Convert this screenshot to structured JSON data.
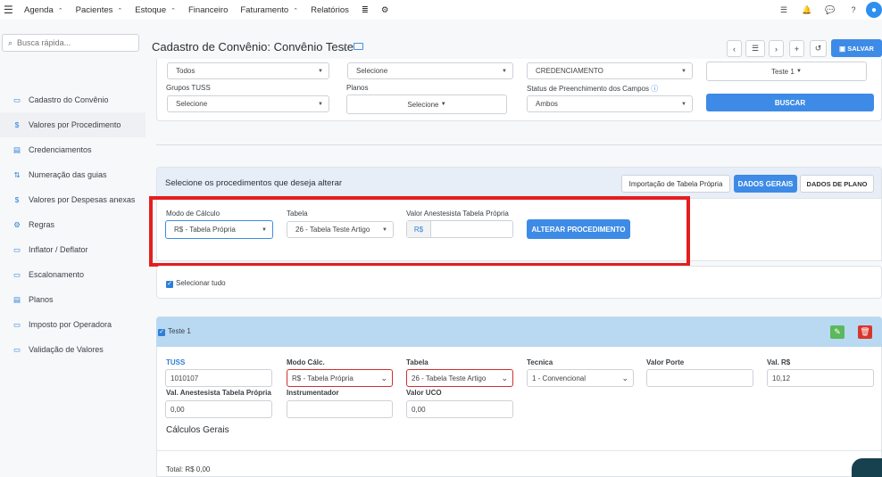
{
  "topbar": {
    "menu_icon": "hamburger-icon",
    "nav": [
      {
        "label": "Agenda",
        "arrow": "⌃"
      },
      {
        "label": "Pacientes",
        "arrow": "⌃"
      },
      {
        "label": "Estoque",
        "arrow": "⌃"
      },
      {
        "label": "Financeiro",
        "arrow": ""
      },
      {
        "label": "Faturamento",
        "arrow": "⌃"
      },
      {
        "label": "Relatórios",
        "arrow": ""
      }
    ],
    "db_icon": "≣",
    "gear_icon": "⚙",
    "right_icons": [
      "☰",
      "🔔",
      "💬",
      "?"
    ]
  },
  "sidebar": {
    "search_placeholder": "Busca rápida...",
    "items": [
      {
        "icon": "▭",
        "label": "Cadastro do Convênio"
      },
      {
        "icon": "$",
        "label": "Valores por Procedimento"
      },
      {
        "icon": "▤",
        "label": "Credenciamentos"
      },
      {
        "icon": "⇅",
        "label": "Numeração das guias"
      },
      {
        "icon": "$",
        "label": "Valores por Despesas anexas"
      },
      {
        "icon": "⚙",
        "label": "Regras"
      },
      {
        "icon": "▭",
        "label": "Inflator / Deflator"
      },
      {
        "icon": "▭",
        "label": "Escalonamento"
      },
      {
        "icon": "▤",
        "label": "Planos"
      },
      {
        "icon": "▭",
        "label": "Imposto por Operadora"
      },
      {
        "icon": "▭",
        "label": "Validação de Valores"
      }
    ]
  },
  "header": {
    "title": "Cadastro de Convênio: Convênio Teste",
    "sep": "/",
    "save": "SALVAR",
    "btns": [
      "‹",
      "☰",
      "›",
      "+",
      "↺"
    ]
  },
  "filters": {
    "row1": [
      "Todos",
      "Selecione",
      "CREDENCIAMENTO",
      "Teste 1"
    ],
    "labels": [
      "Grupos TUSS",
      "Planos",
      "Status de Preenchimento dos Campos"
    ],
    "row2": [
      "Selecione",
      "Selecione",
      "Ambos"
    ],
    "buscar": "BUSCAR"
  },
  "bulk": {
    "title": "Selecione os procedimentos que deseja alterar",
    "tabs": [
      "Importação de Tabela Própria",
      "DADOS GERAIS",
      "DADOS DE PLANO"
    ],
    "modo_label": "Modo de Cálculo",
    "modo_value": "R$ - Tabela Própria",
    "tabela_label": "Tabela",
    "tabela_value": "26 - Tabela Teste Artigo",
    "anest_label": "Valor Anestesista Tabela Própria",
    "currency": "R$",
    "alterar": "ALTERAR PROCEDIMENTO"
  },
  "select_all": "Selecionar tudo",
  "proc": {
    "name": "Teste 1",
    "labels": [
      "TUSS",
      "Modo Cálc.",
      "Tabela",
      "Tecnica",
      "Valor Porte",
      "Val. R$"
    ],
    "values": [
      "1010107",
      "R$ - Tabela Própria",
      "26 - Tabela Teste Artigo",
      "1 - Convencional",
      "",
      "10,12"
    ],
    "labels2": [
      "Val. Anestesista Tabela Própria",
      "Instrumentador",
      "Valor UCO"
    ],
    "values2": [
      "0,00",
      "",
      "0,00"
    ],
    "calc_title": "Cálculos Gerais",
    "total": "Total: R$ 0,00"
  }
}
